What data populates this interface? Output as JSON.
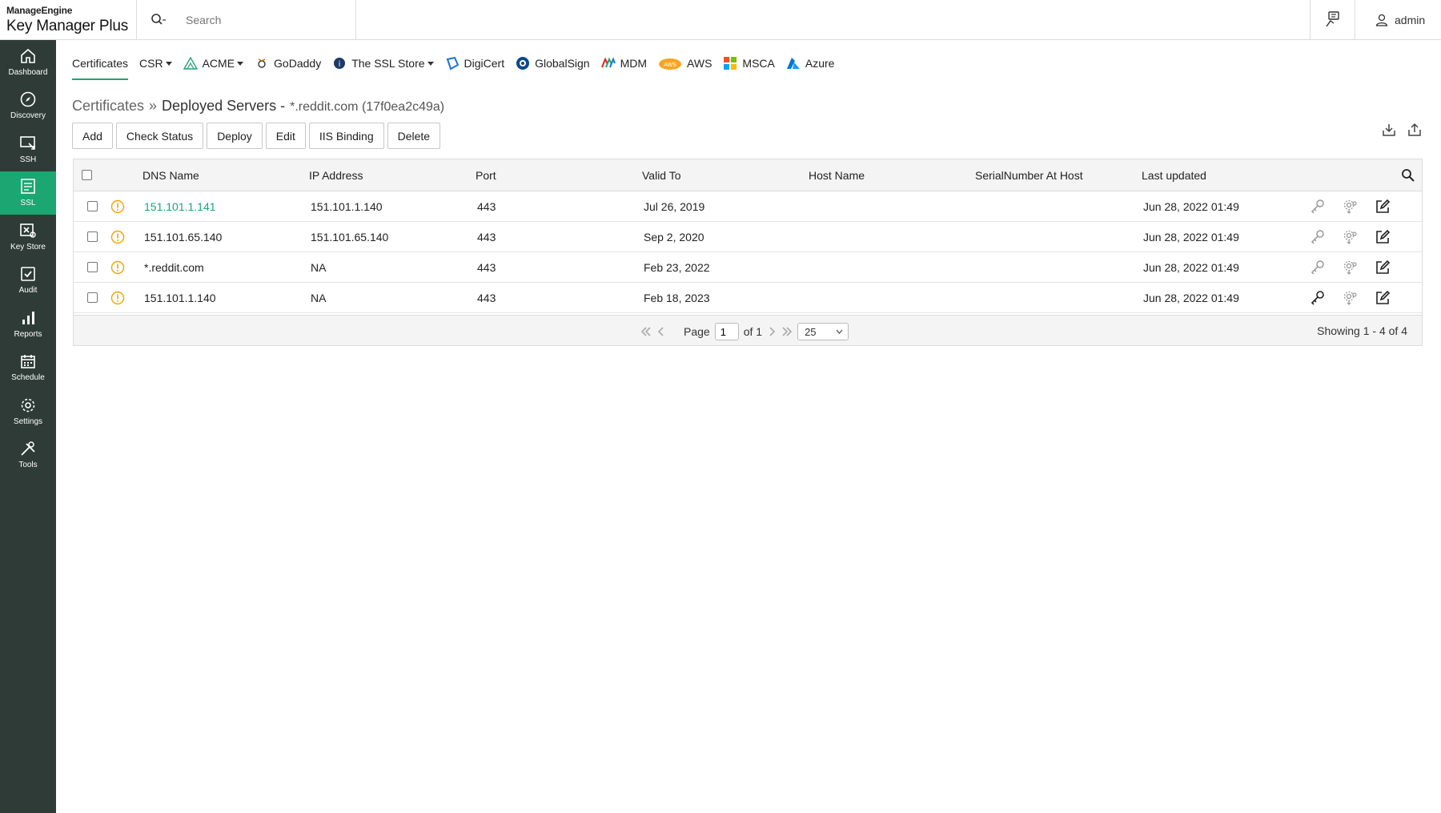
{
  "app": {
    "brand": "ManageEngine",
    "product": "Key Manager Plus",
    "search_placeholder": "Search",
    "user": "admin"
  },
  "sidebar": {
    "items": [
      {
        "label": "Dashboard",
        "icon": "home-icon"
      },
      {
        "label": "Discovery",
        "icon": "compass-icon"
      },
      {
        "label": "SSH",
        "icon": "ssh-icon"
      },
      {
        "label": "SSL",
        "icon": "ssl-icon",
        "active": true
      },
      {
        "label": "Key Store",
        "icon": "key-store-icon"
      },
      {
        "label": "Audit",
        "icon": "audit-icon"
      },
      {
        "label": "Reports",
        "icon": "reports-icon"
      },
      {
        "label": "Schedule",
        "icon": "calendar-icon"
      },
      {
        "label": "Settings",
        "icon": "gear-icon"
      },
      {
        "label": "Tools",
        "icon": "tools-icon"
      }
    ]
  },
  "nav": {
    "tabs": [
      {
        "label": "Certificates",
        "active": true
      },
      {
        "label": "CSR",
        "dropdown": true
      },
      {
        "label": "ACME",
        "dropdown": true
      },
      {
        "label": "GoDaddy"
      },
      {
        "label": "The SSL Store",
        "dropdown": true
      },
      {
        "label": "DigiCert"
      },
      {
        "label": "GlobalSign"
      },
      {
        "label": "MDM"
      },
      {
        "label": "AWS"
      },
      {
        "label": "MSCA"
      },
      {
        "label": "Azure"
      }
    ]
  },
  "breadcrumb": {
    "root": "Certificates",
    "separator": "»",
    "current": "Deployed Servers -",
    "sub": "*.reddit.com (17f0ea2c49a)"
  },
  "toolbar": {
    "buttons": [
      "Add",
      "Check Status",
      "Deploy",
      "Edit",
      "IIS Binding",
      "Delete"
    ]
  },
  "table": {
    "columns": [
      "DNS Name",
      "IP Address",
      "Port",
      "Valid To",
      "Host Name",
      "SerialNumber At Host",
      "Last updated"
    ],
    "rows": [
      {
        "dns": "151.101.1.141",
        "ip": "151.101.1.140",
        "port": "443",
        "valid_to": "Jul 26, 2019",
        "host": "",
        "serial": "",
        "updated": "Jun 28, 2022 01:49",
        "link": true
      },
      {
        "dns": "151.101.65.140",
        "ip": "151.101.65.140",
        "port": "443",
        "valid_to": "Sep 2, 2020",
        "host": "",
        "serial": "",
        "updated": "Jun 28, 2022 01:49"
      },
      {
        "dns": "*.reddit.com",
        "ip": "NA",
        "port": "443",
        "valid_to": "Feb 23, 2022",
        "host": "",
        "serial": "",
        "updated": "Jun 28, 2022 01:49"
      },
      {
        "dns": "151.101.1.140",
        "ip": "NA",
        "port": "443",
        "valid_to": "Feb 18, 2023",
        "host": "",
        "serial": "",
        "updated": "Jun 28, 2022 01:49"
      }
    ]
  },
  "pager": {
    "page_label": "Page",
    "page": "1",
    "of_label": "of 1",
    "page_size": "25",
    "showing": "Showing 1 - 4 of 4"
  },
  "colors": {
    "accent": "#1ba672",
    "sidebar_bg": "#2e3b37",
    "warning": "#f0a400"
  }
}
